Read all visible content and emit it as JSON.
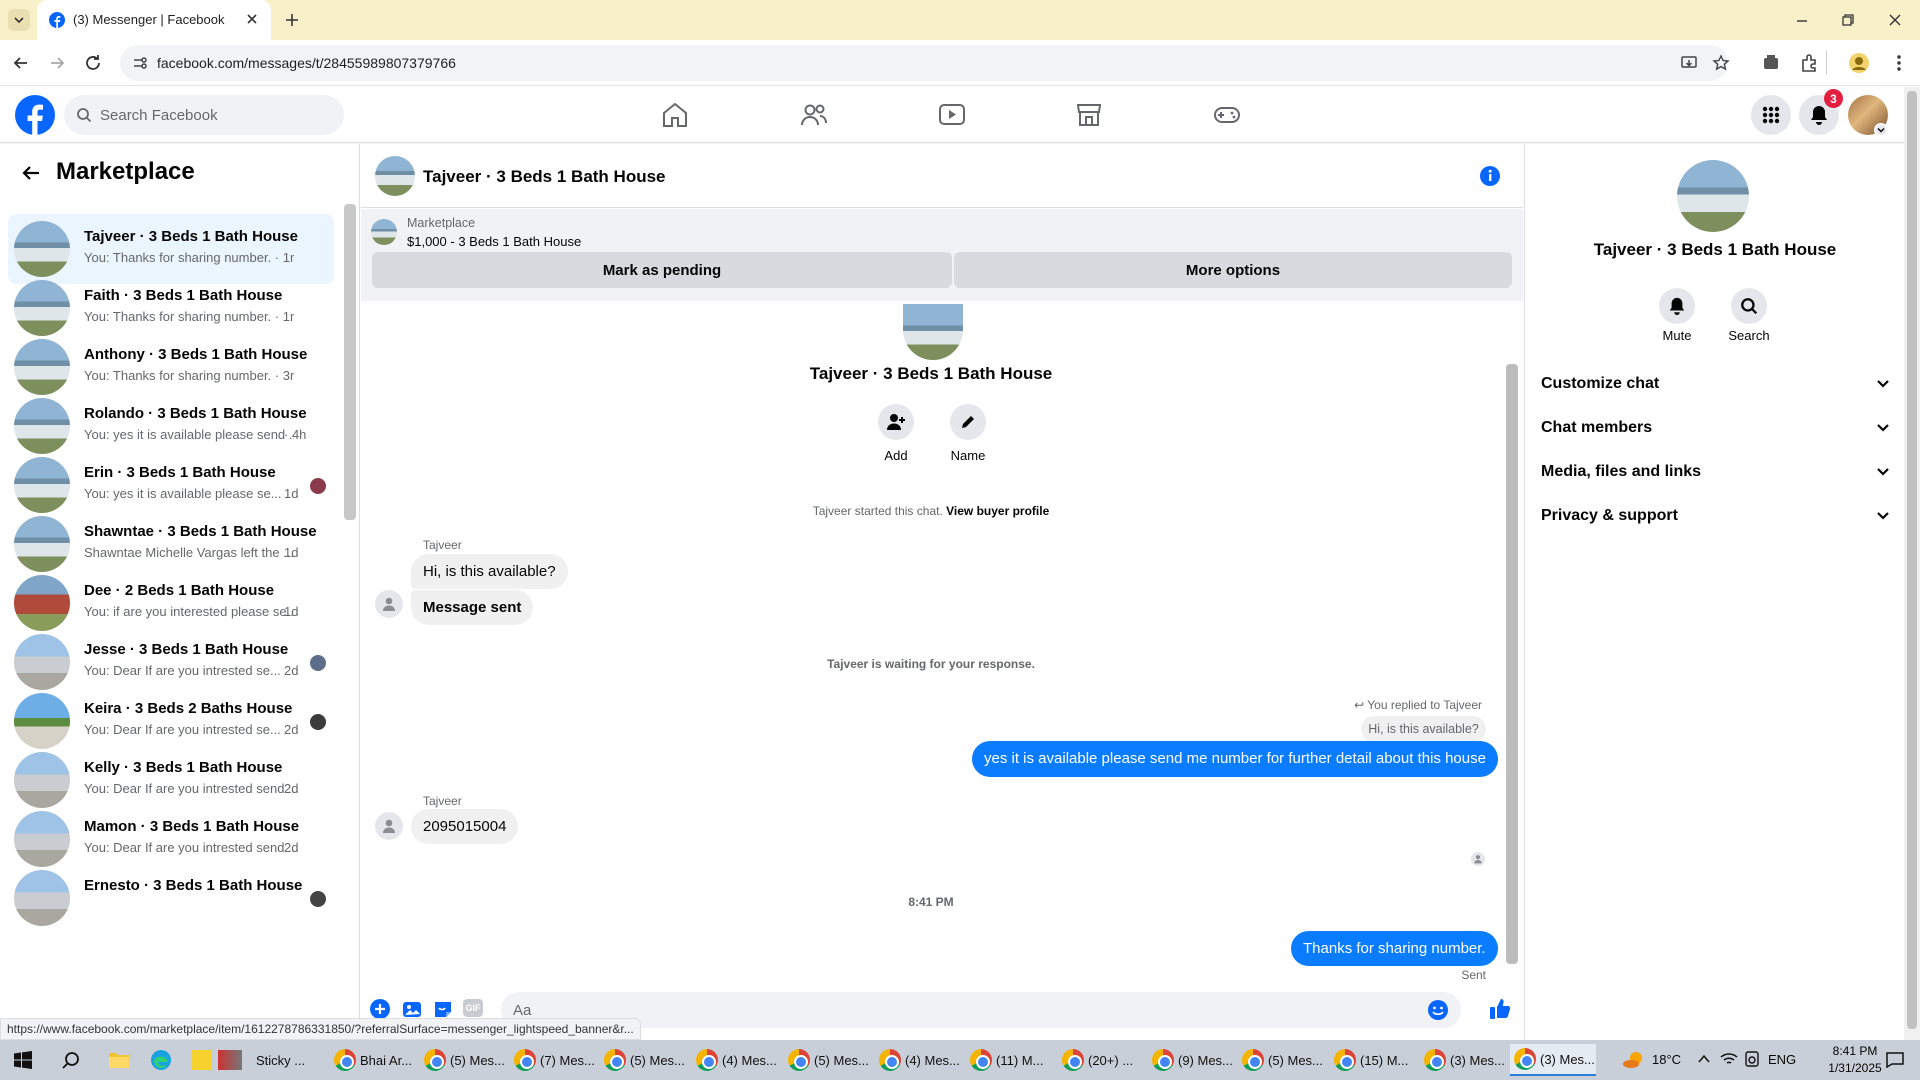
{
  "browser": {
    "tab_title": "(3) Messenger | Facebook",
    "url": "facebook.com/messages/t/28455989807379766",
    "status_url": "https://www.facebook.com/marketplace/item/1612278786331850/?referralSurface=messenger_lightspeed_banner&r..."
  },
  "fb_header": {
    "search_placeholder": "Search Facebook",
    "notification_count": "3"
  },
  "left_panel": {
    "title": "Marketplace",
    "conversations": [
      {
        "name": "Tajveer · 3 Beds 1 Bath House",
        "snippet": "You: Thanks for sharing number. · 1m",
        "time": "",
        "active": true
      },
      {
        "name": "Faith · 3 Beds 1 Bath House",
        "snippet": "You: Thanks for sharing number. · 1m",
        "time": ""
      },
      {
        "name": "Anthony · 3 Beds 1 Bath House",
        "snippet": "You: Thanks for sharing number. · 3m",
        "time": ""
      },
      {
        "name": "Rolando · 3 Beds 1 Bath House",
        "snippet": "You: yes it is available please send ...",
        "time": "· 4h"
      },
      {
        "name": "Erin · 3 Beds 1 Bath House",
        "snippet": "You: yes it is available please se...",
        "time": "1d"
      },
      {
        "name": "Shawntae · 3 Beds 1 Bath House",
        "snippet": "Shawntae Michelle Vargas left the ...",
        "time": "1d"
      },
      {
        "name": "Dee · 2 Beds 1 Bath House",
        "snippet": "You: if are you interested please se...",
        "time": "1d"
      },
      {
        "name": "Jesse · 3 Beds 1 Bath House",
        "snippet": "You: Dear If are you intrested se...",
        "time": "2d"
      },
      {
        "name": "Keira · 3 Beds 2 Baths House",
        "snippet": "You: Dear If are you intrested se...",
        "time": "2d"
      },
      {
        "name": "Kelly · 3 Beds 1 Bath House",
        "snippet": "You: Dear If are you intrested send ...",
        "time": "2d"
      },
      {
        "name": "Mamon · 3 Beds 1 Bath House",
        "snippet": "You: Dear If are you intrested send ...",
        "time": "2d"
      },
      {
        "name": "Ernesto · 3 Beds 1 Bath House",
        "snippet": "",
        "time": ""
      }
    ]
  },
  "chat": {
    "header_name": "Tajveer · 3 Beds 1 Bath House",
    "marketplace_label": "Marketplace",
    "listing": "$1,000 - 3 Beds 1 Bath House",
    "mark_pending": "Mark as pending",
    "more_options": "More options",
    "profile_name": "Tajveer · 3 Beds 1 Bath House",
    "add_label": "Add",
    "name_label": "Name",
    "started_text": "Tajveer started this chat.",
    "view_buyer": "View buyer profile",
    "sender1": "Tajveer",
    "msg1": "Hi, is this available?",
    "msg2": "Message sent",
    "waiting": "Tajveer is waiting for your response.",
    "replied_to": "You replied to Tajveer",
    "quoted": "Hi, is this available?",
    "msg3": "yes it is available please send me number for further detail about this house",
    "sender2": "Tajveer",
    "msg4": "2095015004",
    "timestamp": "8:41 PM",
    "msg5": "Thanks for sharing number.",
    "sent_status": "Sent",
    "composer_placeholder": "Aa"
  },
  "right_panel": {
    "name": "Tajveer · 3 Beds 1 Bath House",
    "mute": "Mute",
    "search": "Search",
    "sections": [
      "Customize chat",
      "Chat members",
      "Media, files and links",
      "Privacy & support"
    ]
  },
  "taskbar": {
    "items": [
      "Sticky ...",
      "Bhai Ar...",
      "(5) Mes...",
      "(7) Mes...",
      "(5) Mes...",
      "(4) Mes...",
      "(5) Mes...",
      "(4) Mes...",
      "(11) M...",
      "(20+) ...",
      "(9) Mes...",
      "(5) Mes...",
      "(15) M...",
      "(3) Mes...",
      "(3) Mes..."
    ],
    "temperature": "18°C",
    "lang": "ENG",
    "time": "8:41 PM",
    "date": "1/31/2025"
  },
  "colors": {
    "fb_blue": "#0866ff",
    "messenger_blue": "#0a7cff",
    "active_conv": "#ebf5ff",
    "tab_strip": "#f8f0c9"
  }
}
